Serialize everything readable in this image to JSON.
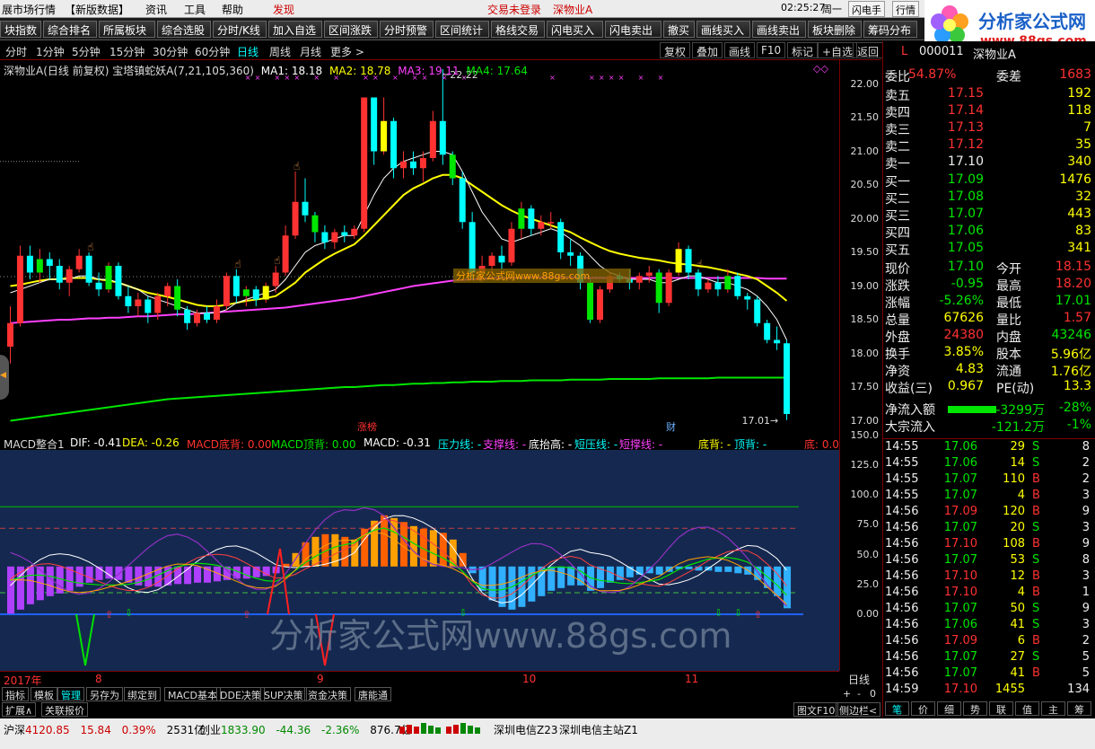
{
  "menu": {
    "items": [
      "展市场行情",
      "【新版数据】",
      "资讯",
      "工具",
      "帮助",
      "发现",
      "交易未登录",
      "深物业A"
    ],
    "time": "02:25:27",
    "weekday": "周一",
    "buttons": [
      "闪电手",
      "行情"
    ]
  },
  "toolbar": {
    "items": [
      "块指数",
      "综合排名",
      "所属板块",
      "综合选股",
      "分时/K线",
      "加入自选",
      "区间涨跌",
      "分时预警",
      "区间统计",
      "格线交易",
      "闪电买入",
      "闪电卖出",
      "撤买",
      "画线买入",
      "画线卖出",
      "板块删除",
      "筹码分布"
    ]
  },
  "logo": {
    "text": "分析家公式网",
    "url": "www.88gs.com"
  },
  "periods": {
    "items": [
      "分时",
      "1分钟",
      "5分钟",
      "15分钟",
      "30分钟",
      "60分钟",
      "日线",
      "周线",
      "月线",
      "更多 >"
    ],
    "active": "日线",
    "right_buttons": [
      "复权",
      "叠加",
      "画线",
      "F10",
      "标记",
      "+自选",
      "返回"
    ]
  },
  "main": {
    "title": "深物业A(日线 前复权) 宝塔镇蛇妖A(7,21,105,360)",
    "ma1": "MA1: 18.18",
    "ma2": "MA2: 18.78",
    "ma3": "MA3: 19.11",
    "ma4": "MA4: 17.64",
    "high_label": "22.22",
    "low_label": "17.01",
    "watermark_small": "分析家公式网www.88gs.com",
    "events": [
      "涨榜",
      "财"
    ],
    "price_ticks": [
      "22.00",
      "21.50",
      "21.00",
      "20.50",
      "20.00",
      "19.50",
      "19.00",
      "18.50",
      "18.00",
      "17.50",
      "17.00"
    ]
  },
  "macd": {
    "title": "MACD整合1",
    "dif": "DIF: -0.41",
    "dea": "DEA: -0.26",
    "bottom_div": "MACD底背: 0.00",
    "top_div": "MACD顶背: 0.00",
    "macd": "MACD: -0.31",
    "pressure": "压力线: -",
    "support": "支撑线: -",
    "bottom_rise": "底抬高: -",
    "short_press": "短压线: -",
    "short_support": "短撑线: -",
    "bottom": "底背: -",
    "top": "顶背: -",
    "di": "底: 0.00",
    "ticks": [
      "150.0",
      "125.0",
      "100.0",
      "75.0",
      "50.0",
      "25.0",
      "0.00"
    ],
    "watermark": "分析家公式网www.88gs.com"
  },
  "dates": {
    "labels": [
      "2017年",
      "8",
      "9",
      "10",
      "11"
    ],
    "period": "日线"
  },
  "bottom_tabs": [
    "指标",
    "模板",
    "管理",
    "另存为",
    "绑定到",
    "MACD基本",
    "DDE决策",
    "SUP决策",
    "资金决策",
    "唐能通"
  ],
  "bottom_tabs2": [
    "扩展∧",
    "关联报价"
  ],
  "bottom_right": [
    "图文F10",
    "侧边栏<"
  ],
  "zoom": [
    "+",
    "-",
    "0"
  ],
  "quote": {
    "code": "000011",
    "name": "深物业A",
    "flag": "L",
    "weibi": {
      "label": "委比",
      "value": "54.87%",
      "label2": "委差",
      "value2": "1683"
    },
    "asks": [
      {
        "label": "卖五",
        "price": "17.15",
        "vol": "192"
      },
      {
        "label": "卖四",
        "price": "17.14",
        "vol": "118"
      },
      {
        "label": "卖三",
        "price": "17.13",
        "vol": "7"
      },
      {
        "label": "卖二",
        "price": "17.12",
        "vol": "35"
      },
      {
        "label": "卖一",
        "price": "17.10",
        "vol": "340"
      }
    ],
    "bids": [
      {
        "label": "买一",
        "price": "17.09",
        "vol": "1476"
      },
      {
        "label": "买二",
        "price": "17.08",
        "vol": "32"
      },
      {
        "label": "买三",
        "price": "17.07",
        "vol": "443"
      },
      {
        "label": "买四",
        "price": "17.06",
        "vol": "83"
      },
      {
        "label": "买五",
        "price": "17.05",
        "vol": "341"
      }
    ],
    "stats": [
      {
        "l1": "现价",
        "v1": "17.10",
        "c1": "green",
        "l2": "今开",
        "v2": "18.15",
        "c2": "red"
      },
      {
        "l1": "涨跌",
        "v1": "-0.95",
        "c1": "green",
        "l2": "最高",
        "v2": "18.20",
        "c2": "red"
      },
      {
        "l1": "涨幅",
        "v1": "-5.26%",
        "c1": "green",
        "l2": "最低",
        "v2": "17.01",
        "c2": "green"
      },
      {
        "l1": "总量",
        "v1": "67626",
        "c1": "yellow",
        "l2": "量比",
        "v2": "1.57",
        "c2": "red"
      },
      {
        "l1": "外盘",
        "v1": "24380",
        "c1": "red",
        "l2": "内盘",
        "v2": "43246",
        "c2": "green"
      },
      {
        "l1": "换手",
        "v1": "3.85%",
        "c1": "yellow",
        "l2": "股本",
        "v2": "5.96亿",
        "c2": "yellow"
      },
      {
        "l1": "净资",
        "v1": "4.83",
        "c1": "yellow",
        "l2": "流通",
        "v2": "1.76亿",
        "c2": "yellow"
      },
      {
        "l1": "收益(三)",
        "v1": "0.967",
        "c1": "yellow",
        "l2": "PE(动)",
        "v2": "13.3",
        "c2": "yellow"
      }
    ],
    "flow": [
      {
        "label": "净流入额",
        "value": "-3299万",
        "pct": "-28%"
      },
      {
        "label": "大宗流入",
        "value": "-121.2万",
        "pct": "-1%"
      }
    ],
    "ticks": [
      {
        "t": "14:55",
        "p": "17.06",
        "v": "29",
        "s": "S",
        "n": "8"
      },
      {
        "t": "14:55",
        "p": "17.06",
        "v": "14",
        "s": "S",
        "n": "2"
      },
      {
        "t": "14:55",
        "p": "17.07",
        "v": "110",
        "s": "B",
        "n": "2"
      },
      {
        "t": "14:55",
        "p": "17.07",
        "v": "4",
        "s": "B",
        "n": "3"
      },
      {
        "t": "14:56",
        "p": "17.09",
        "v": "120",
        "s": "B",
        "n": "9"
      },
      {
        "t": "14:56",
        "p": "17.07",
        "v": "20",
        "s": "S",
        "n": "3"
      },
      {
        "t": "14:56",
        "p": "17.10",
        "v": "108",
        "s": "B",
        "n": "9"
      },
      {
        "t": "14:56",
        "p": "17.07",
        "v": "53",
        "s": "S",
        "n": "8"
      },
      {
        "t": "14:56",
        "p": "17.10",
        "v": "12",
        "s": "B",
        "n": "3"
      },
      {
        "t": "14:56",
        "p": "17.10",
        "v": "4",
        "s": "B",
        "n": "1"
      },
      {
        "t": "14:56",
        "p": "17.07",
        "v": "50",
        "s": "S",
        "n": "9"
      },
      {
        "t": "14:56",
        "p": "17.06",
        "v": "41",
        "s": "S",
        "n": "3"
      },
      {
        "t": "14:56",
        "p": "17.09",
        "v": "6",
        "s": "B",
        "n": "2"
      },
      {
        "t": "14:56",
        "p": "17.07",
        "v": "27",
        "s": "S",
        "n": "5"
      },
      {
        "t": "14:56",
        "p": "17.07",
        "v": "41",
        "s": "B",
        "n": "5"
      },
      {
        "t": "14:59",
        "p": "17.10",
        "v": "1455",
        "s": "",
        "n": "134"
      }
    ],
    "tabs": [
      "笔",
      "价",
      "细",
      "势",
      "联",
      "值",
      "主",
      "筹"
    ]
  },
  "status": {
    "sh": {
      "label": "沪深",
      "value": "4120.85",
      "chg": "15.84",
      "pct": "0.39%",
      "amt": "2531亿"
    },
    "cy": {
      "label": "创业",
      "value": "1833.90",
      "chg": "-44.36",
      "pct": "-2.36%",
      "amt": "876.7亿"
    },
    "server": "深圳电信Z23",
    "server2": "深圳电信主站Z1"
  },
  "colors": {
    "up": "#ff3232",
    "down": "#00ffff",
    "ma1": "#ffffff",
    "ma2": "#ffff00",
    "ma3": "#ff40ff",
    "ma4": "#00e600"
  },
  "chart_data": {
    "type": "candlestick",
    "title": "深物业A(日线 前复权)",
    "ylim": [
      16.9,
      22.3
    ],
    "x": [
      "2017-07",
      "2017-08",
      "2017-09",
      "2017-10",
      "2017-11"
    ],
    "ohlc": [
      [
        18.1,
        18.7,
        17.85,
        18.45
      ],
      [
        18.45,
        19.6,
        18.4,
        19.45
      ],
      [
        19.45,
        19.6,
        19.1,
        19.2
      ],
      [
        19.2,
        19.55,
        19.05,
        19.4
      ],
      [
        19.4,
        19.5,
        19.1,
        19.3
      ],
      [
        19.3,
        19.4,
        18.95,
        19.05
      ],
      [
        19.05,
        19.3,
        18.85,
        19.25
      ],
      [
        19.25,
        19.55,
        19.2,
        19.45
      ],
      [
        19.45,
        19.5,
        19.0,
        19.05
      ],
      [
        19.05,
        19.2,
        18.85,
        18.95
      ],
      [
        18.95,
        19.35,
        18.9,
        19.3
      ],
      [
        19.3,
        19.35,
        18.8,
        18.85
      ],
      [
        18.85,
        19.0,
        18.6,
        18.7
      ],
      [
        18.7,
        18.9,
        18.55,
        18.8
      ],
      [
        18.8,
        18.85,
        18.45,
        18.6
      ],
      [
        18.6,
        18.9,
        18.5,
        18.85
      ],
      [
        18.85,
        19.05,
        18.7,
        19.0
      ],
      [
        19.0,
        19.1,
        18.55,
        18.65
      ],
      [
        18.65,
        18.7,
        18.35,
        18.45
      ],
      [
        18.45,
        18.65,
        18.4,
        18.6
      ],
      [
        18.6,
        18.7,
        18.45,
        18.5
      ],
      [
        18.5,
        18.8,
        18.45,
        18.7
      ],
      [
        18.7,
        19.2,
        18.65,
        19.15
      ],
      [
        19.15,
        19.25,
        18.75,
        18.85
      ],
      [
        18.85,
        19.0,
        18.7,
        18.95
      ],
      [
        18.95,
        19.0,
        18.7,
        18.8
      ],
      [
        18.8,
        19.05,
        18.75,
        19.0
      ],
      [
        19.0,
        19.3,
        18.9,
        19.2
      ],
      [
        19.2,
        19.9,
        19.15,
        19.75
      ],
      [
        19.75,
        20.7,
        19.7,
        20.25
      ],
      [
        20.25,
        20.6,
        19.95,
        20.05
      ],
      [
        20.05,
        20.1,
        19.65,
        19.8
      ],
      [
        19.8,
        19.9,
        19.55,
        19.65
      ],
      [
        19.65,
        19.85,
        19.55,
        19.8
      ],
      [
        19.8,
        19.9,
        19.65,
        19.75
      ],
      [
        19.75,
        19.9,
        19.7,
        19.85
      ],
      [
        19.85,
        21.8,
        19.8,
        21.8
      ],
      [
        21.8,
        21.8,
        20.8,
        21.0
      ],
      [
        21.0,
        21.8,
        20.95,
        21.45
      ],
      [
        21.45,
        21.5,
        20.6,
        20.75
      ],
      [
        20.75,
        21.0,
        20.6,
        20.85
      ],
      [
        20.85,
        21.0,
        20.65,
        20.75
      ],
      [
        20.75,
        21.0,
        20.55,
        20.9
      ],
      [
        20.9,
        21.6,
        20.85,
        21.45
      ],
      [
        21.45,
        22.22,
        20.8,
        20.95
      ],
      [
        20.95,
        21.0,
        20.5,
        20.6
      ],
      [
        20.6,
        20.7,
        19.85,
        19.95
      ],
      [
        19.95,
        20.1,
        19.1,
        19.2
      ],
      [
        19.2,
        19.45,
        19.05,
        19.3
      ],
      [
        19.3,
        19.5,
        19.1,
        19.45
      ],
      [
        19.45,
        19.6,
        19.25,
        19.35
      ],
      [
        19.35,
        19.95,
        19.3,
        19.85
      ],
      [
        19.85,
        20.25,
        19.7,
        20.15
      ],
      [
        20.15,
        20.2,
        19.75,
        19.85
      ],
      [
        19.85,
        20.05,
        19.75,
        19.95
      ],
      [
        19.95,
        20.1,
        19.85,
        19.95
      ],
      [
        19.95,
        20.0,
        19.4,
        19.5
      ],
      [
        19.5,
        19.7,
        19.3,
        19.45
      ],
      [
        19.45,
        19.5,
        18.95,
        19.05
      ],
      [
        19.05,
        19.1,
        18.45,
        18.5
      ],
      [
        18.5,
        19.0,
        18.45,
        18.95
      ],
      [
        18.95,
        19.2,
        18.9,
        19.15
      ],
      [
        19.15,
        19.2,
        19.05,
        19.1
      ],
      [
        19.1,
        19.25,
        18.95,
        19.05
      ],
      [
        19.05,
        19.2,
        18.95,
        19.15
      ],
      [
        19.15,
        19.3,
        19.05,
        19.2
      ],
      [
        19.2,
        19.25,
        18.6,
        18.75
      ],
      [
        18.75,
        19.25,
        18.7,
        19.2
      ],
      [
        19.2,
        19.65,
        19.15,
        19.55
      ],
      [
        19.55,
        19.6,
        19.1,
        19.2
      ],
      [
        19.2,
        19.25,
        18.85,
        18.95
      ],
      [
        18.95,
        19.1,
        18.9,
        19.05
      ],
      [
        19.05,
        19.15,
        18.85,
        18.95
      ],
      [
        18.95,
        19.25,
        18.9,
        19.15
      ],
      [
        19.15,
        19.2,
        18.8,
        18.85
      ],
      [
        18.85,
        18.9,
        18.65,
        18.8
      ],
      [
        18.8,
        18.85,
        18.4,
        18.45
      ],
      [
        18.45,
        18.5,
        18.15,
        18.2
      ],
      [
        18.2,
        18.4,
        18.05,
        18.15
      ],
      [
        18.15,
        18.2,
        17.01,
        17.1
      ]
    ],
    "ma": {
      "ma1": [
        18.9,
        18.95,
        19.0,
        19.05,
        19.1,
        19.1,
        19.1,
        19.15,
        19.15,
        19.1,
        19.1,
        19.05,
        19.0,
        18.95,
        18.85,
        18.8,
        18.75,
        18.7,
        18.65,
        18.6,
        18.6,
        18.6,
        18.65,
        18.75,
        18.8,
        18.85,
        18.9,
        18.95,
        19.1,
        19.3,
        19.5,
        19.6,
        19.65,
        19.7,
        19.75,
        19.75,
        20.05,
        20.35,
        20.6,
        20.75,
        20.85,
        20.9,
        20.95,
        21.0,
        21.0,
        20.95,
        20.7,
        20.4,
        20.1,
        19.9,
        19.7,
        19.65,
        19.7,
        19.75,
        19.8,
        19.85,
        19.8,
        19.7,
        19.6,
        19.45,
        19.3,
        19.2,
        19.15,
        19.1,
        19.1,
        19.1,
        19.05,
        19.05,
        19.1,
        19.15,
        19.15,
        19.1,
        19.05,
        19.05,
        19.0,
        18.95,
        18.85,
        18.7,
        18.5,
        18.2
      ],
      "ma2": [
        19.0,
        19.02,
        19.05,
        19.08,
        19.1,
        19.1,
        19.12,
        19.12,
        19.12,
        19.1,
        19.08,
        19.05,
        19.0,
        18.95,
        18.9,
        18.87,
        18.84,
        18.8,
        18.76,
        18.72,
        18.7,
        18.7,
        18.72,
        18.75,
        18.78,
        18.8,
        18.82,
        18.85,
        18.95,
        19.05,
        19.2,
        19.3,
        19.4,
        19.48,
        19.55,
        19.62,
        19.75,
        19.9,
        20.05,
        20.2,
        20.35,
        20.45,
        20.52,
        20.6,
        20.65,
        20.65,
        20.6,
        20.5,
        20.4,
        20.3,
        20.2,
        20.12,
        20.05,
        20.0,
        19.95,
        19.9,
        19.85,
        19.8,
        19.72,
        19.65,
        19.58,
        19.52,
        19.48,
        19.45,
        19.42,
        19.4,
        19.38,
        19.35,
        19.33,
        19.32,
        19.3,
        19.28,
        19.25,
        19.22,
        19.18,
        19.15,
        19.1,
        19.0,
        18.9,
        18.78
      ],
      "ma3": [
        18.45,
        18.46,
        18.47,
        18.48,
        18.49,
        18.5,
        18.5,
        18.51,
        18.52,
        18.52,
        18.53,
        18.53,
        18.54,
        18.55,
        18.55,
        18.56,
        18.57,
        18.58,
        18.58,
        18.59,
        18.6,
        18.61,
        18.62,
        18.63,
        18.64,
        18.65,
        18.66,
        18.67,
        18.68,
        18.7,
        18.72,
        18.74,
        18.76,
        18.78,
        18.8,
        18.82,
        18.85,
        18.88,
        18.91,
        18.94,
        18.97,
        19.0,
        19.02,
        19.04,
        19.06,
        19.08,
        19.09,
        19.1,
        19.11,
        19.12,
        19.12,
        19.12,
        19.12,
        19.13,
        19.13,
        19.13,
        19.13,
        19.13,
        19.13,
        19.12,
        19.12,
        19.12,
        19.12,
        19.12,
        19.12,
        19.12,
        19.12,
        19.12,
        19.12,
        19.12,
        19.12,
        19.12,
        19.12,
        19.12,
        19.12,
        19.12,
        19.12,
        19.11,
        19.11,
        19.11
      ],
      "ma4": [
        17.0,
        17.02,
        17.04,
        17.06,
        17.08,
        17.1,
        17.12,
        17.14,
        17.16,
        17.18,
        17.2,
        17.22,
        17.24,
        17.26,
        17.28,
        17.3,
        17.32,
        17.33,
        17.34,
        17.35,
        17.36,
        17.37,
        17.38,
        17.39,
        17.4,
        17.41,
        17.42,
        17.43,
        17.44,
        17.45,
        17.46,
        17.47,
        17.48,
        17.49,
        17.5,
        17.5,
        17.51,
        17.52,
        17.53,
        17.53,
        17.54,
        17.55,
        17.55,
        17.56,
        17.56,
        17.57,
        17.57,
        17.58,
        17.58,
        17.58,
        17.59,
        17.59,
        17.59,
        17.6,
        17.6,
        17.6,
        17.6,
        17.61,
        17.61,
        17.61,
        17.61,
        17.62,
        17.62,
        17.62,
        17.62,
        17.62,
        17.63,
        17.63,
        17.63,
        17.63,
        17.63,
        17.63,
        17.64,
        17.64,
        17.64,
        17.64,
        17.64,
        17.64,
        17.64,
        17.64
      ]
    },
    "macd_hist": [
      -0.35,
      -0.32,
      -0.28,
      -0.25,
      -0.22,
      -0.2,
      -0.18,
      -0.15,
      -0.12,
      -0.1,
      -0.09,
      -0.1,
      -0.12,
      -0.14,
      -0.15,
      -0.15,
      -0.14,
      -0.13,
      -0.13,
      -0.12,
      -0.12,
      -0.11,
      -0.1,
      -0.09,
      -0.09,
      -0.08,
      -0.07,
      -0.05,
      0.02,
      0.1,
      0.18,
      0.22,
      0.24,
      0.24,
      0.22,
      0.2,
      0.28,
      0.34,
      0.38,
      0.36,
      0.33,
      0.3,
      0.28,
      0.27,
      0.25,
      0.2,
      0.1,
      -0.05,
      -0.18,
      -0.25,
      -0.3,
      -0.32,
      -0.3,
      -0.26,
      -0.22,
      -0.18,
      -0.16,
      -0.14,
      -0.14,
      -0.18,
      -0.16,
      -0.12,
      -0.1,
      -0.08,
      -0.06,
      -0.05,
      -0.06,
      -0.04,
      -0.02,
      -0.02,
      -0.03,
      -0.03,
      -0.04,
      -0.04,
      -0.05,
      -0.06,
      -0.1,
      -0.16,
      -0.22,
      -0.31
    ]
  }
}
